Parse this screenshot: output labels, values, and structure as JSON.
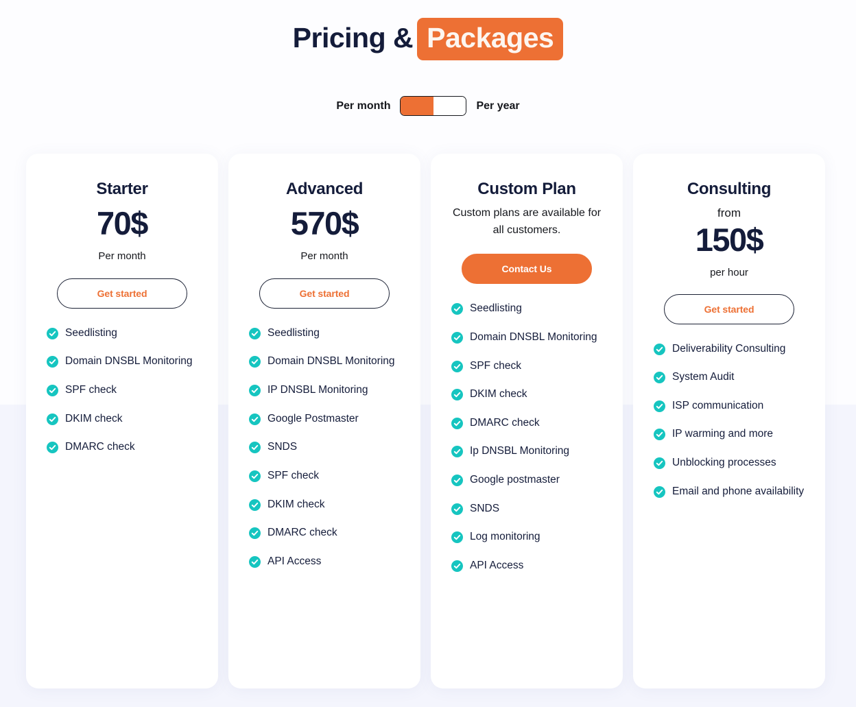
{
  "header": {
    "title_plain": "Pricing &",
    "title_highlight": "Packages",
    "highlight_color": "#ed7034"
  },
  "billing_toggle": {
    "left_label": "Per month",
    "right_label": "Per year",
    "selected": "Per month",
    "active_color": "#ed7034"
  },
  "theme": {
    "accent": "#ed7034",
    "navy": "#141c3a",
    "check": "#16c5c0",
    "page_bg": "#f4f5fd",
    "card_bg": "#ffffff"
  },
  "plans": [
    {
      "name": "Starter",
      "price_pre": "",
      "price": "70$",
      "price_sub": "Per month",
      "description": "",
      "cta_label": "Get started",
      "cta_style": "outline",
      "features": [
        "Seedlisting",
        "Domain DNSBL Monitoring",
        "SPF check",
        "DKIM check",
        "DMARC check"
      ]
    },
    {
      "name": "Advanced",
      "price_pre": "",
      "price": "570$",
      "price_sub": "Per month",
      "description": "",
      "cta_label": "Get started",
      "cta_style": "outline",
      "features": [
        "Seedlisting",
        "Domain DNSBL Monitoring",
        "IP DNSBL Monitoring",
        "Google Postmaster",
        "SNDS",
        "SPF check",
        "DKIM check",
        "DMARC check",
        "API Access"
      ]
    },
    {
      "name": "Custom Plan",
      "price_pre": "",
      "price": "",
      "price_sub": "",
      "description": "Custom plans are available for all customers.",
      "cta_label": "Contact Us",
      "cta_style": "solid",
      "features": [
        "Seedlisting",
        "Domain DNSBL Monitoring",
        "SPF check",
        "DKIM check",
        "DMARC check",
        "Ip DNSBL Monitoring",
        "Google postmaster",
        "SNDS",
        "Log monitoring",
        "API Access"
      ]
    },
    {
      "name": "Consulting",
      "price_pre": "from",
      "price": "150$",
      "price_sub": "per hour",
      "description": "",
      "cta_label": "Get started",
      "cta_style": "outline",
      "features": [
        "Deliverability Consulting",
        "System Audit",
        "ISP communication",
        "IP warming and more",
        "Unblocking processes",
        "Email and phone availability"
      ]
    }
  ]
}
